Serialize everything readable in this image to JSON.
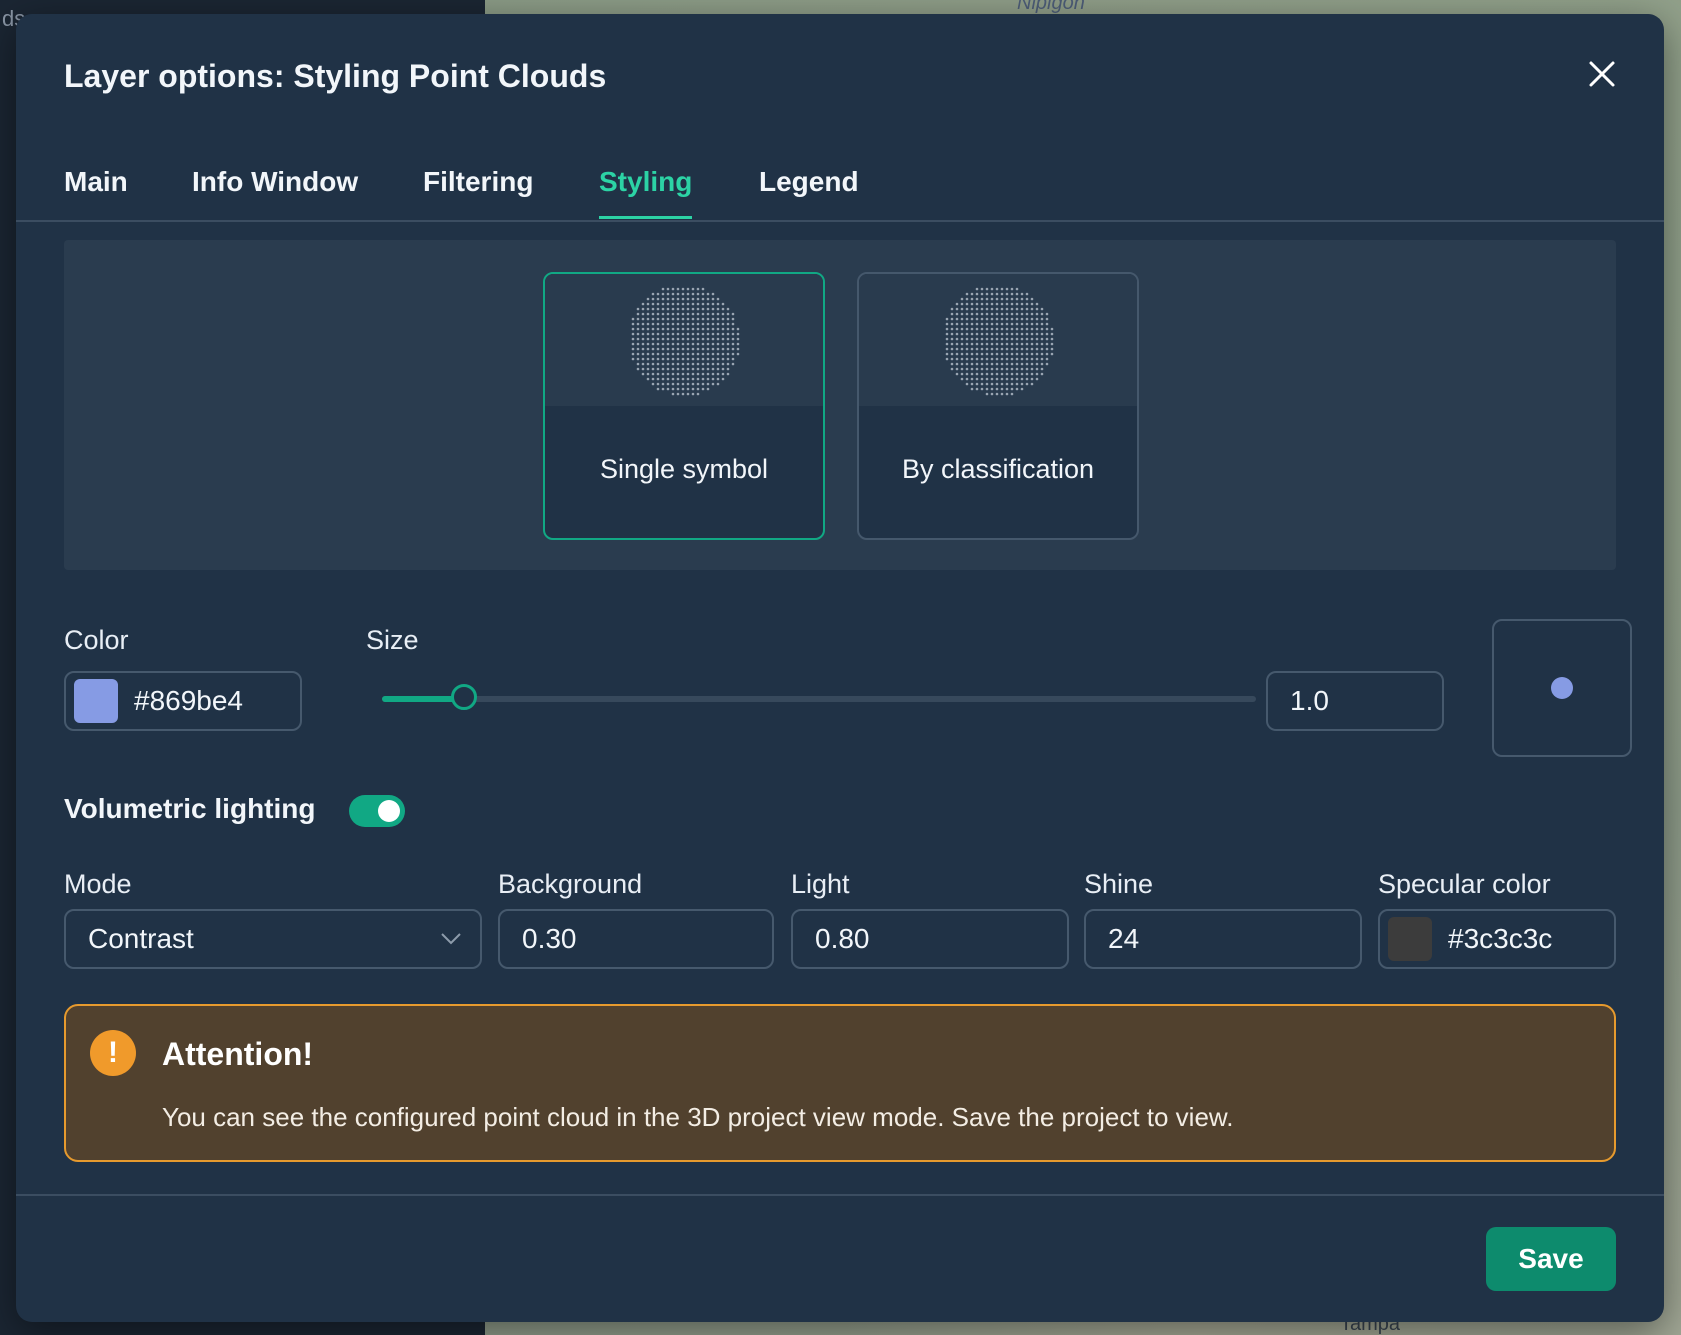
{
  "background": {
    "left_text": "ds",
    "map_labels": [
      "Nipigon",
      "Tampa"
    ]
  },
  "modal": {
    "title": "Layer options: Styling Point Clouds"
  },
  "tabs": [
    {
      "label": "Main",
      "active": false
    },
    {
      "label": "Info Window",
      "active": false
    },
    {
      "label": "Filtering",
      "active": false
    },
    {
      "label": "Styling",
      "active": true
    },
    {
      "label": "Legend",
      "active": false
    }
  ],
  "styling_types": [
    {
      "label": "Single symbol",
      "selected": true
    },
    {
      "label": "By classification",
      "selected": false
    }
  ],
  "color": {
    "label": "Color",
    "value": "#869be4",
    "swatch": "#869be4"
  },
  "size": {
    "label": "Size",
    "value": "1.0",
    "slider_fraction": 0.094
  },
  "volumetric_lighting": {
    "label": "Volumetric lighting",
    "enabled": true
  },
  "mode": {
    "label": "Mode",
    "value": "Contrast"
  },
  "background_field": {
    "label": "Background",
    "value": "0.30"
  },
  "light": {
    "label": "Light",
    "value": "0.80"
  },
  "shine": {
    "label": "Shine",
    "value": "24"
  },
  "specular_color": {
    "label": "Specular color",
    "value": "#3c3c3c",
    "swatch": "#3c3c3c"
  },
  "alert": {
    "title": "Attention!",
    "icon": "!",
    "message": "You can see the configured point cloud in the 3D project view mode. Save the project to view."
  },
  "footer": {
    "save_label": "Save"
  },
  "colors": {
    "accent": "#2cd3a5",
    "primary_button": "#0d8b6d",
    "warning": "#e69a2e"
  }
}
